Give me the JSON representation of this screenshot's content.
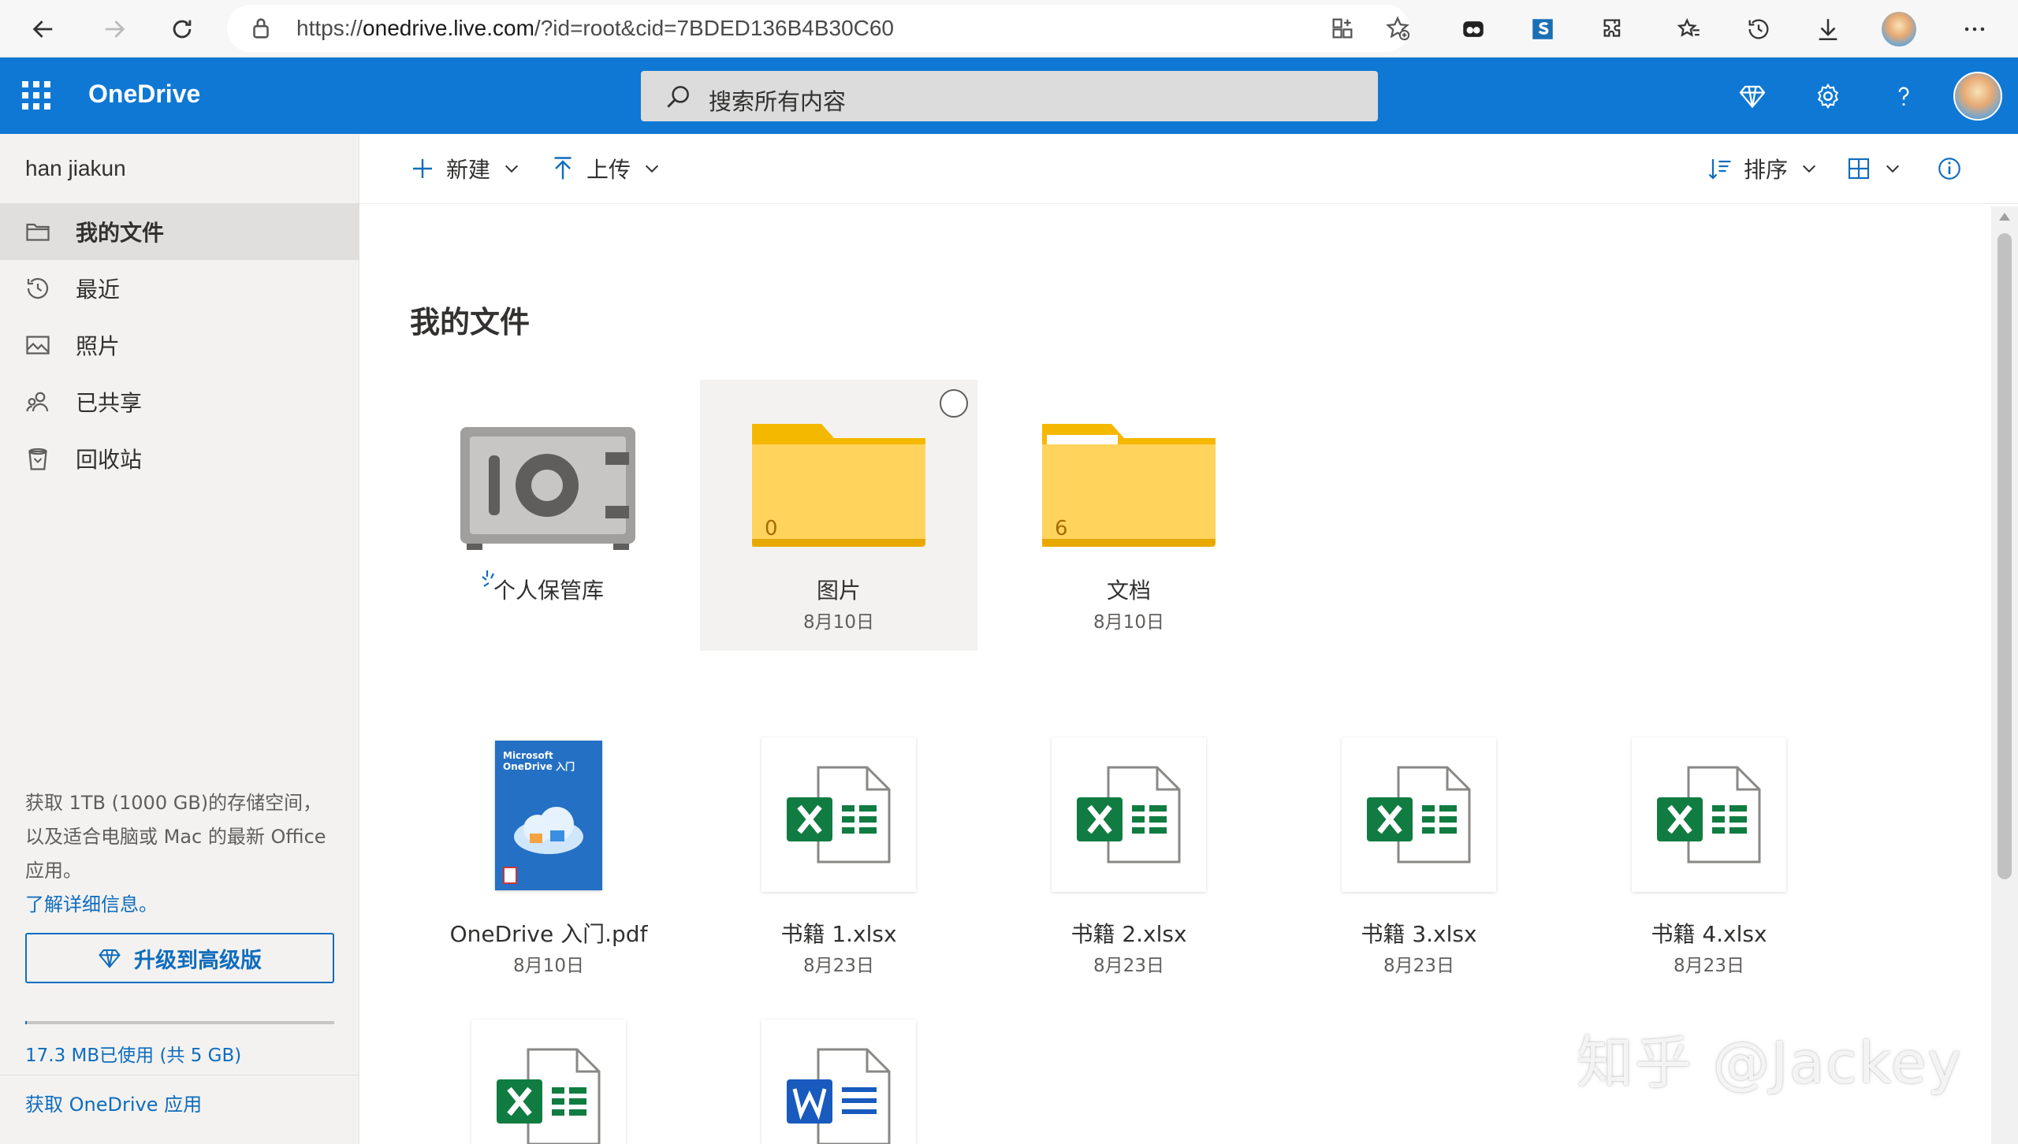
{
  "browser": {
    "url_prefix": "https://",
    "url_host": "onedrive.live.com",
    "url_path": "/?id=root&cid=7BDED136B4B30C60"
  },
  "suite": {
    "app_name": "OneDrive",
    "search_placeholder": "搜索所有内容"
  },
  "sidebar": {
    "user_name": "han jiakun",
    "items": [
      {
        "label": "我的文件",
        "icon": "folder-icon",
        "active": true
      },
      {
        "label": "最近",
        "icon": "history-icon",
        "active": false
      },
      {
        "label": "照片",
        "icon": "image-icon",
        "active": false
      },
      {
        "label": "已共享",
        "icon": "people-icon",
        "active": false
      },
      {
        "label": "回收站",
        "icon": "recycle-bin-icon",
        "active": false
      }
    ],
    "promo_text": "获取 1TB (1000 GB)的存储空间，以及适合电脑或 Mac 的最新 Office 应用。",
    "learn_more": "了解详细信息。",
    "upgrade_label": "升级到高级版",
    "storage_used_fraction": 0.003,
    "storage_text": "17.3 MB已使用 (共 5 GB)",
    "get_app": "获取 OneDrive 应用"
  },
  "commands": {
    "new_label": "新建",
    "upload_label": "上传",
    "sort_label": "排序"
  },
  "main": {
    "title": "我的文件",
    "folders": [
      {
        "name": "个人保管库",
        "date": "",
        "type": "vault"
      },
      {
        "name": "图片",
        "date": "8月10日",
        "count": "0",
        "selected": true
      },
      {
        "name": "文档",
        "date": "8月10日",
        "count": "6",
        "selected": false
      }
    ],
    "files": [
      {
        "name": "OneDrive 入门.pdf",
        "date": "8月10日",
        "type": "pdf",
        "thumb_line1": "Microsoft",
        "thumb_line2": "OneDrive 入门"
      },
      {
        "name": "书籍 1.xlsx",
        "date": "8月23日",
        "type": "xlsx"
      },
      {
        "name": "书籍 2.xlsx",
        "date": "8月23日",
        "type": "xlsx"
      },
      {
        "name": "书籍 3.xlsx",
        "date": "8月23日",
        "type": "xlsx"
      },
      {
        "name": "书籍 4.xlsx",
        "date": "8月23日",
        "type": "xlsx"
      },
      {
        "name": "",
        "date": "",
        "type": "xlsx"
      },
      {
        "name": "",
        "date": "",
        "type": "docx"
      }
    ]
  },
  "watermark": "知乎 @Jackey",
  "colors": {
    "brand_blue": "#0f78d4",
    "link_blue": "#0f6cbd",
    "excel_green": "#107c41",
    "word_blue": "#185abd",
    "folder_yellow": "#ffd35c"
  }
}
